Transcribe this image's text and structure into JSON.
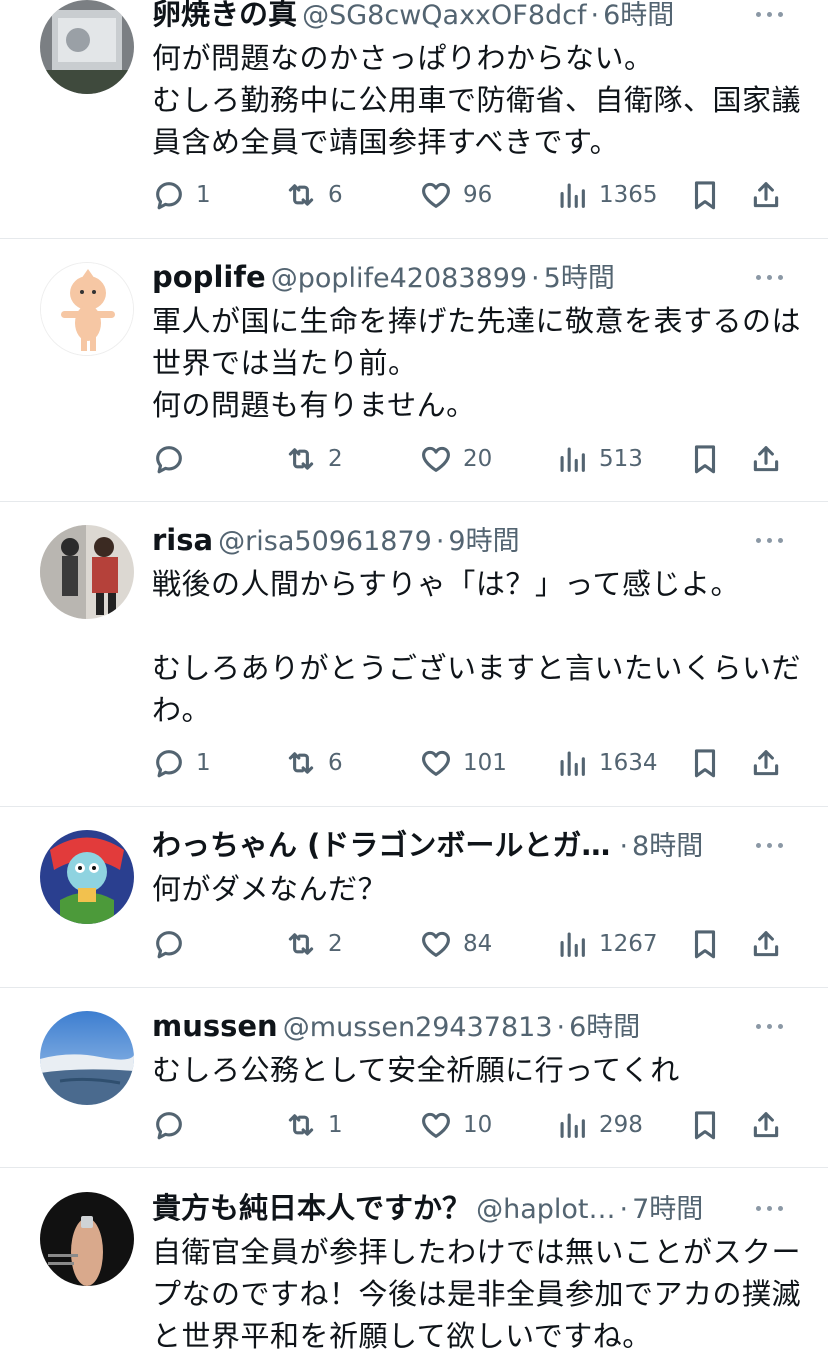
{
  "tweets": [
    {
      "name": "卵焼きの真",
      "handle": "@SG8cwQaxxOF8dcf",
      "time": "6時間",
      "text": "何が問題なのかさっぱりわからない。\nむしろ勤務中に公用車で防衛省、自衛隊、国家議員含め全員で靖国参拝すべきです。",
      "replies": "1",
      "retweets": "6",
      "likes": "96",
      "views": "1365"
    },
    {
      "name": "poplife",
      "handle": "@poplife42083899",
      "time": "5時間",
      "text": "軍人が国に生命を捧げた先達に敬意を表するのは世界では当たり前。\n何の問題も有りません。",
      "replies": "",
      "retweets": "2",
      "likes": "20",
      "views": "513"
    },
    {
      "name": "risa",
      "handle": "@risa50961879",
      "time": "9時間",
      "text": "戦後の人間からすりゃ「は？」って感じよ。\n\nむしろありがとうございますと言いたいくらいだわ。",
      "replies": "1",
      "retweets": "6",
      "likes": "101",
      "views": "1634"
    },
    {
      "name": "わっちゃん (ドラゴンボールとガ…",
      "handle": "",
      "time": "8時間",
      "text": "何がダメなんだ？",
      "replies": "",
      "retweets": "2",
      "likes": "84",
      "views": "1267"
    },
    {
      "name": "mussen",
      "handle": "@mussen29437813",
      "time": "6時間",
      "text": "むしろ公務として安全祈願に行ってくれ",
      "replies": "",
      "retweets": "1",
      "likes": "10",
      "views": "298"
    },
    {
      "name": "貴方も純日本人ですか？",
      "handle": "@haplot…",
      "time": "7時間",
      "text": "自衛官全員が参拝したわけでは無いことがスクープなのですね！今後は是非全員参加でアカの撲滅と世界平和を祈願して欲しいですね。",
      "replies": "",
      "retweets": "",
      "likes": "",
      "views": ""
    }
  ],
  "icons": [
    "reply-icon",
    "retweet-icon",
    "like-icon",
    "views-icon",
    "bookmark-icon",
    "share-icon",
    "more-icon"
  ],
  "colors": {
    "text": "#0f1419",
    "secondary": "#536471",
    "divider": "#e6e9ec"
  }
}
